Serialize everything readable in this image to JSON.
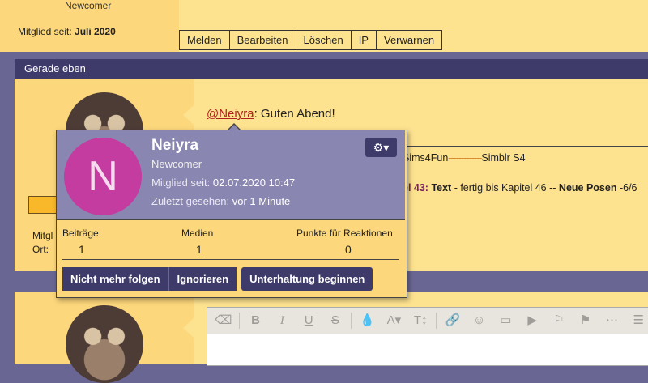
{
  "post_top": {
    "rank": "Newcomer",
    "member_since_label": "Mitglied seit:",
    "member_since_value": "Juli 2020",
    "actions": [
      "Melden",
      "Bearbeiten",
      "Löschen",
      "IP",
      "Verwarnen"
    ]
  },
  "post_header": {
    "time": "Gerade eben"
  },
  "post_main": {
    "mention": "@Neiyra",
    "text": ": Guten Abend!",
    "signature_line1_a": "Sims4Fun",
    "signature_line1_dashes": "-------------",
    "signature_line1_b": "Simblr S4",
    "signature_line2_a": "el 43:",
    "signature_line2_b": " Text",
    "signature_line2_c": " - fertig bis Kapitel 46 -- ",
    "signature_line2_d": "Neue Posen",
    "signature_line2_e": " -6/6",
    "side_label1": "Mitgl",
    "side_label2": "Ort:"
  },
  "editor": {
    "tools": [
      "eraser-icon",
      "bold-icon",
      "italic-icon",
      "underline-icon",
      "strike-icon",
      "drop-icon",
      "font-color-icon",
      "text-size-icon",
      "link-icon",
      "smiley-icon",
      "image-icon",
      "media-icon",
      "video-icon",
      "flag-icon",
      "checkered-flag-icon",
      "more-icon",
      "align-icon"
    ],
    "bold": "B",
    "italic": "I",
    "underline": "U",
    "strike": "S"
  },
  "card": {
    "initial": "N",
    "name": "Neiyra",
    "title": "Newcomer",
    "joined_label": "Mitglied seit:",
    "joined_value": "02.07.2020 10:47",
    "seen_label": "Zuletzt gesehen:",
    "seen_value": "vor 1 Minute",
    "stats": [
      {
        "label": "Beiträge",
        "value": "1"
      },
      {
        "label": "Medien",
        "value": "1"
      },
      {
        "label": "Punkte für Reaktionen",
        "value": "0"
      }
    ],
    "buttons": {
      "unfollow": "Nicht mehr folgen",
      "ignore": "Ignorieren",
      "conversation": "Unterhaltung beginnen"
    },
    "avatar_color": "#c43c9f"
  },
  "colors": {
    "background": "#6a6694",
    "post_user_bg": "#fcd77b",
    "post_msg_bg": "#fde28f",
    "header_bg": "#3e3b6b",
    "mention": "#b0201e"
  }
}
